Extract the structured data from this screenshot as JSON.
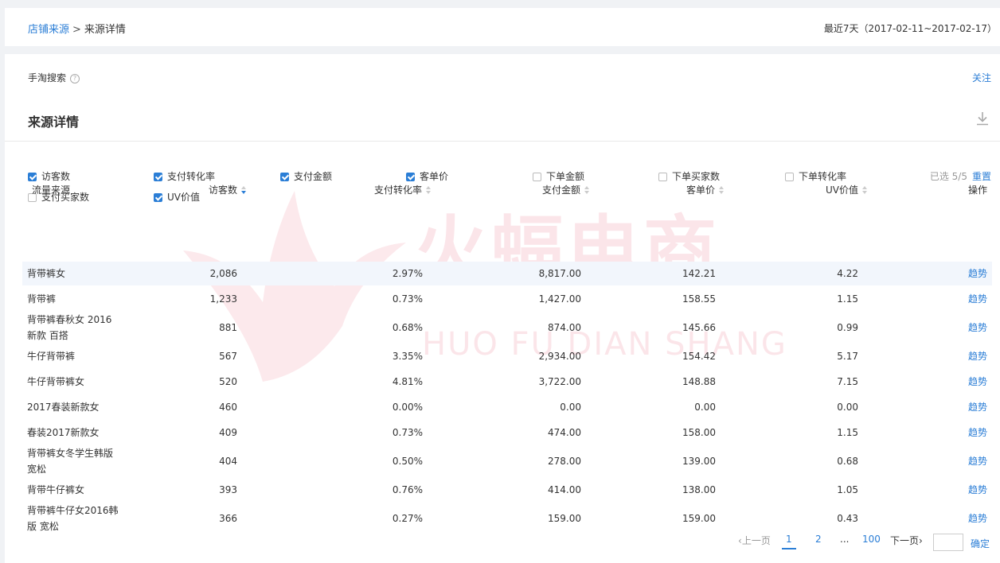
{
  "breadcrumb": {
    "parent": "店铺来源",
    "separator": ">",
    "current": "来源详情"
  },
  "date_range": "最近7天（2017-02-11~2017-02-17）",
  "source": {
    "name": "手淘搜索",
    "help": "?",
    "follow": "关注"
  },
  "section": {
    "title": "来源详情"
  },
  "metrics": [
    {
      "label": "访客数",
      "checked": true
    },
    {
      "label": "支付转化率",
      "checked": true
    },
    {
      "label": "支付金额",
      "checked": true
    },
    {
      "label": "客单价",
      "checked": true
    },
    {
      "label": "下单金额",
      "checked": false
    },
    {
      "label": "下单买家数",
      "checked": false
    },
    {
      "label": "下单转化率",
      "checked": false
    },
    {
      "label": "支付买家数",
      "checked": false
    },
    {
      "label": "UV价值",
      "checked": true
    }
  ],
  "selected": "已选 5/5",
  "reset": "重置",
  "columns": [
    "流量来源",
    "访客数",
    "支付转化率",
    "支付金额",
    "客单价",
    "UV价值",
    "操作"
  ],
  "rows": [
    {
      "name": [
        "背带裤女"
      ],
      "visitors": "2,086",
      "conv": "2.97%",
      "amount": "8,817.00",
      "aov": "142.21",
      "uv": "4.22",
      "action": "趋势"
    },
    {
      "name": [
        "背带裤"
      ],
      "visitors": "1,233",
      "conv": "0.73%",
      "amount": "1,427.00",
      "aov": "158.55",
      "uv": "1.15",
      "action": "趋势"
    },
    {
      "name": [
        "背带裤春秋女 2016",
        "新款 百搭"
      ],
      "visitors": "881",
      "conv": "0.68%",
      "amount": "874.00",
      "aov": "145.66",
      "uv": "0.99",
      "action": "趋势"
    },
    {
      "name": [
        "牛仔背带裤"
      ],
      "visitors": "567",
      "conv": "3.35%",
      "amount": "2,934.00",
      "aov": "154.42",
      "uv": "5.17",
      "action": "趋势"
    },
    {
      "name": [
        "牛仔背带裤女"
      ],
      "visitors": "520",
      "conv": "4.81%",
      "amount": "3,722.00",
      "aov": "148.88",
      "uv": "7.15",
      "action": "趋势"
    },
    {
      "name": [
        "2017春装新款女"
      ],
      "visitors": "460",
      "conv": "0.00%",
      "amount": "0.00",
      "aov": "0.00",
      "uv": "0.00",
      "action": "趋势"
    },
    {
      "name": [
        "春装2017新款女"
      ],
      "visitors": "409",
      "conv": "0.73%",
      "amount": "474.00",
      "aov": "158.00",
      "uv": "1.15",
      "action": "趋势"
    },
    {
      "name": [
        "背带裤女冬学生韩版",
        "宽松"
      ],
      "visitors": "404",
      "conv": "0.50%",
      "amount": "278.00",
      "aov": "139.00",
      "uv": "0.68",
      "action": "趋势"
    },
    {
      "name": [
        "背带牛仔裤女"
      ],
      "visitors": "393",
      "conv": "0.76%",
      "amount": "414.00",
      "aov": "138.00",
      "uv": "1.05",
      "action": "趋势"
    },
    {
      "name": [
        "背带裤牛仔女2016韩",
        "版 宽松"
      ],
      "visitors": "366",
      "conv": "0.27%",
      "amount": "159.00",
      "aov": "159.00",
      "uv": "0.43",
      "action": "趋势"
    }
  ],
  "watermark": {
    "cn": "火蝠电商",
    "en": "HUO FU DIAN SHANG"
  },
  "pagination": {
    "prev": "上一页",
    "pages": [
      "1",
      "2",
      "...",
      "100"
    ],
    "next": "下一页",
    "go": "确定"
  },
  "colors": {
    "link": "#2b7ed6",
    "highlight_row": "#f2f6fc"
  }
}
